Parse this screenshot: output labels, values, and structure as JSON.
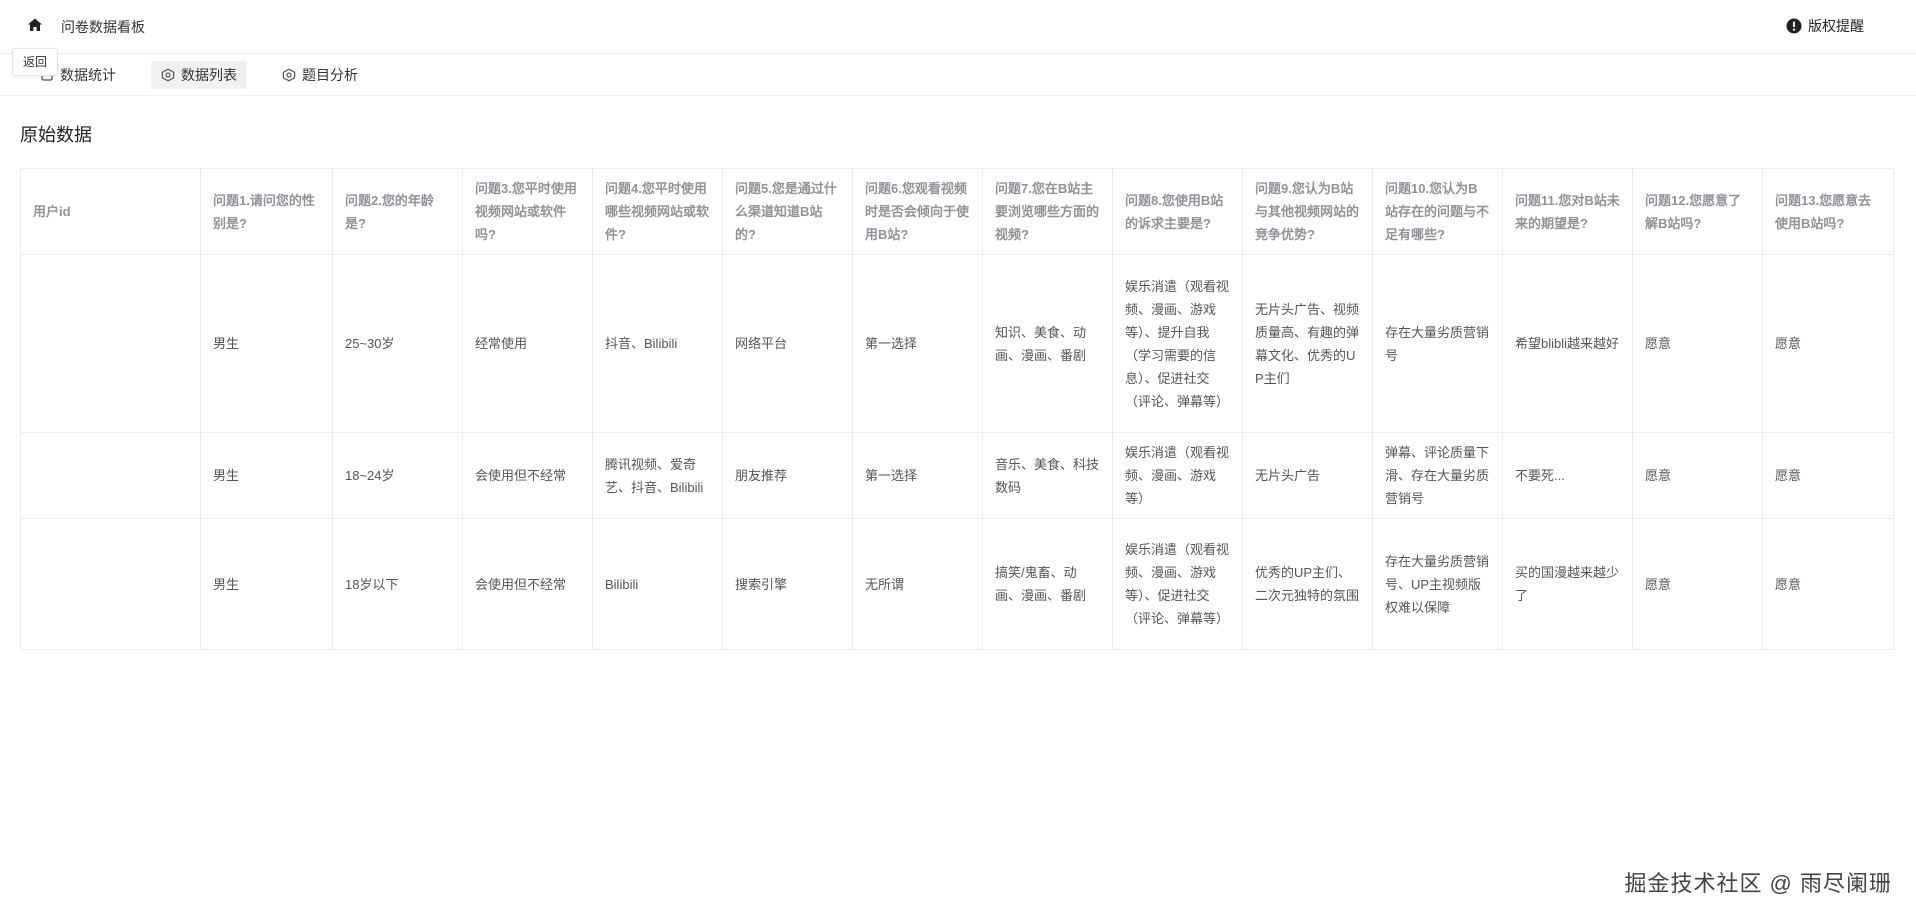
{
  "app": {
    "title": "问卷数据看板",
    "home_icon": "home-icon",
    "back_tooltip": "返回",
    "copyright_label": "版权提醒",
    "copyright_icon": "alert-circle-icon"
  },
  "tabs": [
    {
      "label": "数据统计",
      "icon": "chart-icon",
      "active": false
    },
    {
      "label": "数据列表",
      "icon": "list-icon",
      "active": true
    },
    {
      "label": "题目分析",
      "icon": "analysis-icon",
      "active": false
    }
  ],
  "section": {
    "title": "原始数据"
  },
  "table": {
    "headers": [
      "用户id",
      "问题1.请问您的性别是?",
      "问题2.您的年龄是?",
      "问题3.您平时使用视频网站或软件吗?",
      "问题4.您平时使用哪些视频网站或软件?",
      "问题5.您是通过什么渠道知道B站的?",
      "问题6.您观看视频时是否会倾向于使用B站?",
      "问题7.您在B站主要浏览哪些方面的视频?",
      "问题8.您使用B站的诉求主要是?",
      "问题9.您认为B站与其他视频网站的竞争优势?",
      "问题10.您认为B站存在的问题与不足有哪些?",
      "问题11.您对B站未来的期望是?",
      "问题12.您愿意了解B站吗?",
      "问题13.您愿意去使用B站吗?"
    ],
    "rows": [
      [
        "",
        "男生",
        "25~30岁",
        "经常使用",
        "抖音、Bilibili",
        "网络平台",
        "第一选择",
        "知识、美食、动画、漫画、番剧",
        "娱乐消遣（观看视频、漫画、游戏等）、提升自我（学习需要的信息）、促进社交（评论、弹幕等）",
        "无片头广告、视频质量高、有趣的弹幕文化、优秀的UP主们",
        "存在大量劣质营销号",
        "希望blibli越来越好",
        "愿意",
        "愿意"
      ],
      [
        "",
        "男生",
        "18~24岁",
        "会使用但不经常",
        "腾讯视频、爱奇艺、抖音、Bilibili",
        "朋友推荐",
        "第一选择",
        "音乐、美食、科技数码",
        "娱乐消遣（观看视频、漫画、游戏等）",
        "无片头广告",
        "弹幕、评论质量下滑、存在大量劣质营销号",
        "不要死...",
        "愿意",
        "愿意"
      ],
      [
        "",
        "男生",
        "18岁以下",
        "会使用但不经常",
        "Bilibili",
        "搜索引擎",
        "无所谓",
        "搞笑/鬼畜、动画、漫画、番剧",
        "娱乐消遣（观看视频、漫画、游戏等）、促进社交（评论、弹幕等）",
        "优秀的UP主们、二次元独特的氛围",
        "存在大量劣质营销号、UP主视频版权难以保障",
        "买的国漫越来越少了",
        "愿意",
        "愿意"
      ]
    ]
  },
  "watermark": "掘金技术社区 @ 雨尽阑珊"
}
